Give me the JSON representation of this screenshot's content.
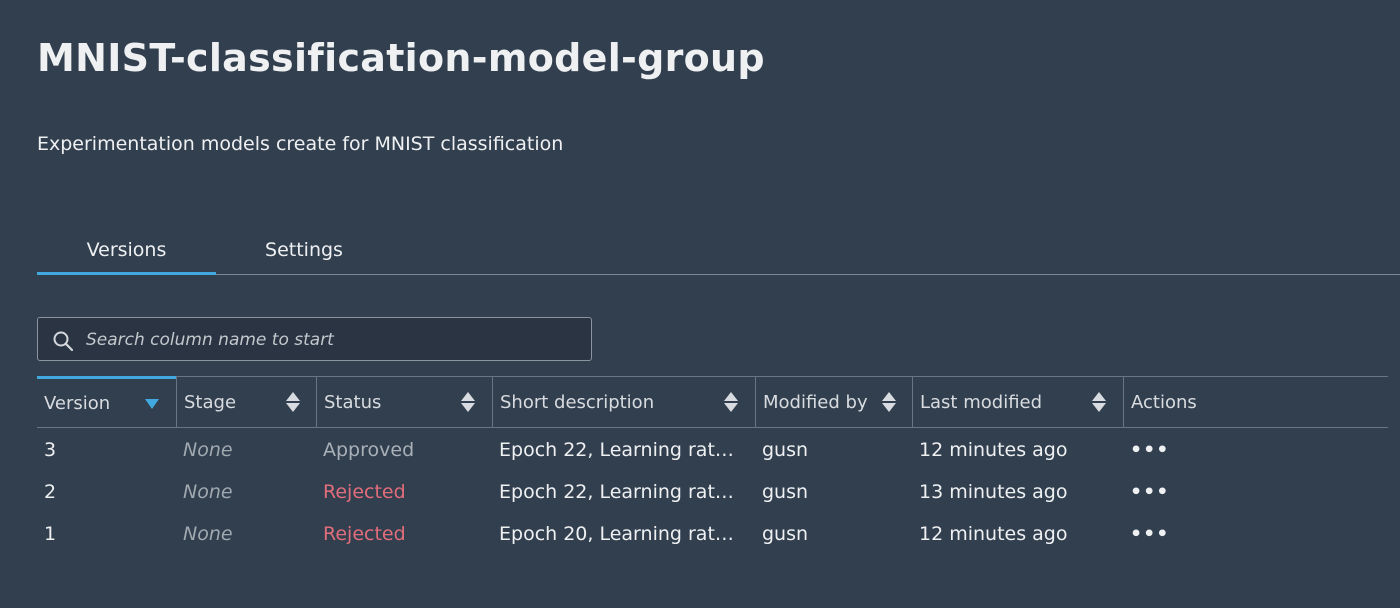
{
  "header": {
    "title": "MNIST-classification-model-group",
    "description": "Experimentation models create for MNIST classification"
  },
  "tabs": [
    {
      "label": "Versions",
      "active": true
    },
    {
      "label": "Settings",
      "active": false
    }
  ],
  "search": {
    "placeholder": "Search column name to start",
    "value": ""
  },
  "table": {
    "columns": [
      "Version",
      "Stage",
      "Status",
      "Short description",
      "Modified by",
      "Last modified",
      "Actions"
    ],
    "sorted_column": "Version",
    "sort_direction": "descending",
    "rows": [
      {
        "version": "3",
        "stage": "None",
        "status": "Approved",
        "description": "Epoch 22, Learning rat…",
        "modified_by": "gusn",
        "last_modified": "12 minutes ago",
        "actions": "•••"
      },
      {
        "version": "2",
        "stage": "None",
        "status": "Rejected",
        "description": "Epoch 22, Learning rat…",
        "modified_by": "gusn",
        "last_modified": "13 minutes ago",
        "actions": "•••"
      },
      {
        "version": "1",
        "stage": "None",
        "status": "Rejected",
        "description": "Epoch 20, Learning rat…",
        "modified_by": "gusn",
        "last_modified": "12 minutes ago",
        "actions": "•••"
      }
    ]
  },
  "colors": {
    "background": "#323f4f",
    "accent": "#41a9e0",
    "rejected": "#e26d7b",
    "approved": "#a9b0b7"
  }
}
